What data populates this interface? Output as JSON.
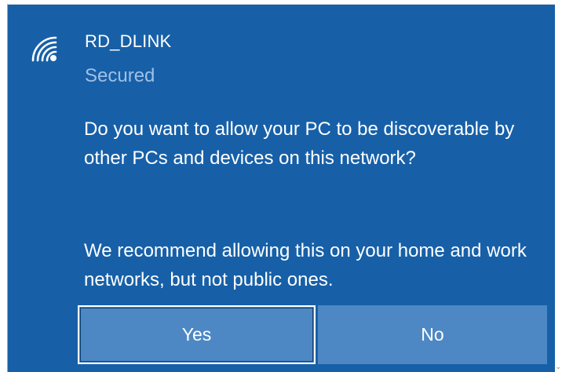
{
  "network": {
    "ssid": "RD_DLINK",
    "status": "Secured",
    "icon": "wifi-secured-icon"
  },
  "prompt": {
    "question": "Do you want to allow your PC to be discoverable by other PCs and devices on this network?",
    "recommendation": "We recommend allowing this on your home and work networks, but not public ones."
  },
  "buttons": {
    "yes_label": "Yes",
    "no_label": "No"
  },
  "colors": {
    "panel_background": "#1760a8",
    "button_background": "#4d88c4",
    "secondary_text": "#9fc0e6",
    "primary_text": "#ffffff"
  }
}
